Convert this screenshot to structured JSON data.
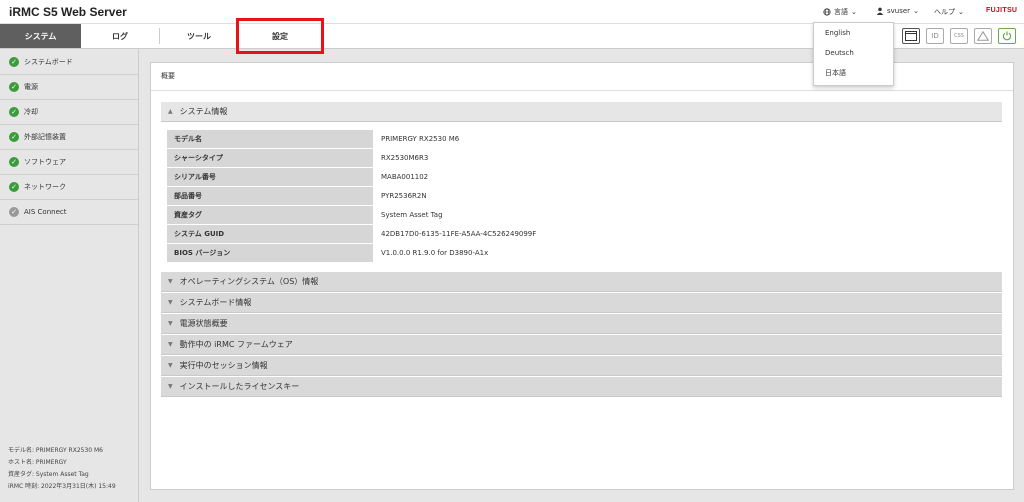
{
  "header": {
    "title": "iRMC S5 Web Server",
    "lang_label": "言語",
    "user_label": "svuser",
    "help_label": "ヘルプ",
    "logo": "FUJITSU"
  },
  "nav": {
    "tabs": [
      {
        "label": "システム"
      },
      {
        "label": "ログ"
      },
      {
        "label": "ツール"
      },
      {
        "label": "設定"
      }
    ]
  },
  "toolbar": {
    "icons": [
      "window-icon",
      "id-icon",
      "css-icon",
      "warning-icon",
      "power-icon"
    ],
    "id_text": "ID",
    "css_text": "CSS"
  },
  "lang_dropdown": {
    "items": [
      "English",
      "Deutsch",
      "日本語"
    ]
  },
  "sidebar": {
    "items": [
      {
        "label": "システムボード",
        "status": "ok"
      },
      {
        "label": "電源",
        "status": "ok"
      },
      {
        "label": "冷却",
        "status": "ok"
      },
      {
        "label": "外部記憶装置",
        "status": "ok"
      },
      {
        "label": "ソフトウェア",
        "status": "ok"
      },
      {
        "label": "ネットワーク",
        "status": "ok"
      },
      {
        "label": "AIS Connect",
        "status": "neutral"
      }
    ],
    "footer": {
      "model": "モデル名: PRIMERGY RX2530 M6",
      "host": "ホスト名: PRIMERGY",
      "asset": "資産タグ: System Asset Tag",
      "time": "iRMC 時刻: 2022年3月31日(木) 15:49"
    }
  },
  "main": {
    "title": "概要",
    "system_info": {
      "header": "システム情報",
      "rows": [
        {
          "key": "モデル名",
          "value": "PRIMERGY RX2530 M6"
        },
        {
          "key": "シャーシタイプ",
          "value": "RX2530M6R3"
        },
        {
          "key": "シリアル番号",
          "value": "MABA001102"
        },
        {
          "key": "部品番号",
          "value": "PYR2536R2N"
        },
        {
          "key": "資産タグ",
          "value": "System Asset Tag"
        },
        {
          "key": "システム GUID",
          "value": "42DB17D0-6135-11FE-A5AA-4C526249099F"
        },
        {
          "key": "BIOS バージョン",
          "value": "V1.0.0.0 R1.9.0 for D3890-A1x"
        }
      ]
    },
    "sections": [
      "オペレーティングシステム（OS）情報",
      "システムボード情報",
      "電源状態概要",
      "動作中の iRMC ファームウェア",
      "実行中のセッション情報",
      "インストールしたライセンスキー"
    ]
  }
}
